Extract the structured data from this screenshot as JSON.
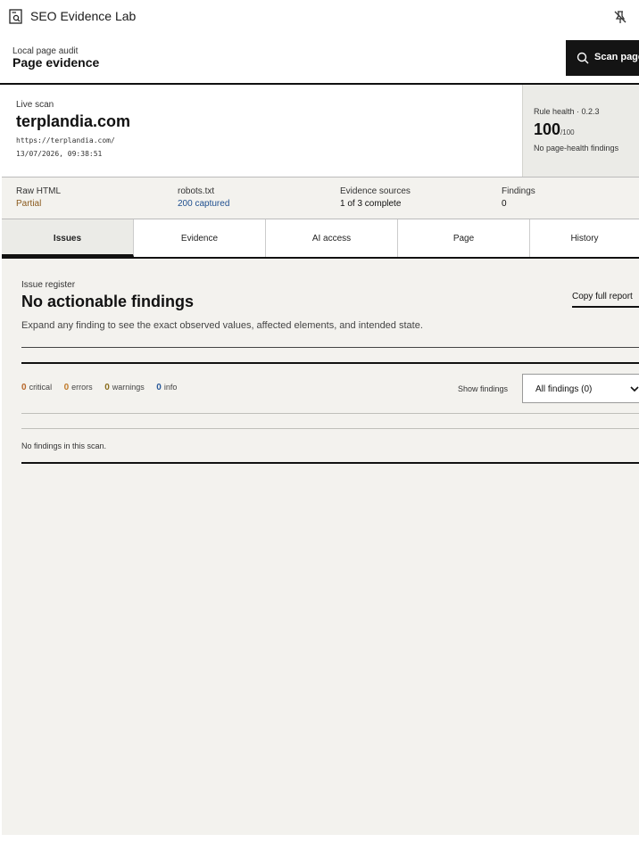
{
  "window": {
    "title": "SEO Evidence Lab"
  },
  "header": {
    "kicker": "Local page audit",
    "title": "Page evidence",
    "scan_label": "Scan page"
  },
  "scan": {
    "kicker": "Live scan",
    "domain": "terplandia.com",
    "url": "https://terplandia.com/",
    "timestamp": "13/07/2026, 09:38:51"
  },
  "health": {
    "label": "Rule health · 0.2.3",
    "score": "100",
    "max": "/100",
    "note": "No page-health findings"
  },
  "stats": [
    {
      "label": "Raw HTML",
      "value": "Partial",
      "color": "#8a5a1e"
    },
    {
      "label": "robots.txt",
      "value": "200 captured",
      "color": "#1f4f8f"
    },
    {
      "label": "Evidence sources",
      "value": "1 of 3 complete",
      "color": "#111111"
    },
    {
      "label": "Findings",
      "value": "0",
      "color": "#111111"
    }
  ],
  "tabs": [
    "Issues",
    "Evidence",
    "AI access",
    "Page",
    "History"
  ],
  "register": {
    "kicker": "Issue register",
    "title": "No actionable findings",
    "description": "Expand any finding to see the exact observed values, affected elements, and intended state.",
    "copy_label": "Copy full report"
  },
  "counts": {
    "critical": {
      "n": "0",
      "label": "critical",
      "color": "#b7672a"
    },
    "errors": {
      "n": "0",
      "label": "errors",
      "color": "#c07a2a"
    },
    "warnings": {
      "n": "0",
      "label": "warnings",
      "color": "#8a6d1e"
    },
    "info": {
      "n": "0",
      "label": "info",
      "color": "#2a5a9a"
    }
  },
  "filter": {
    "label": "Show findings",
    "selected": "All findings (0)"
  },
  "empty_text": "No findings in this scan.",
  "icons": {
    "app": "app-document-icon",
    "pin": "unpin-icon",
    "search": "search-icon",
    "chevron": "chevron-down-icon"
  }
}
